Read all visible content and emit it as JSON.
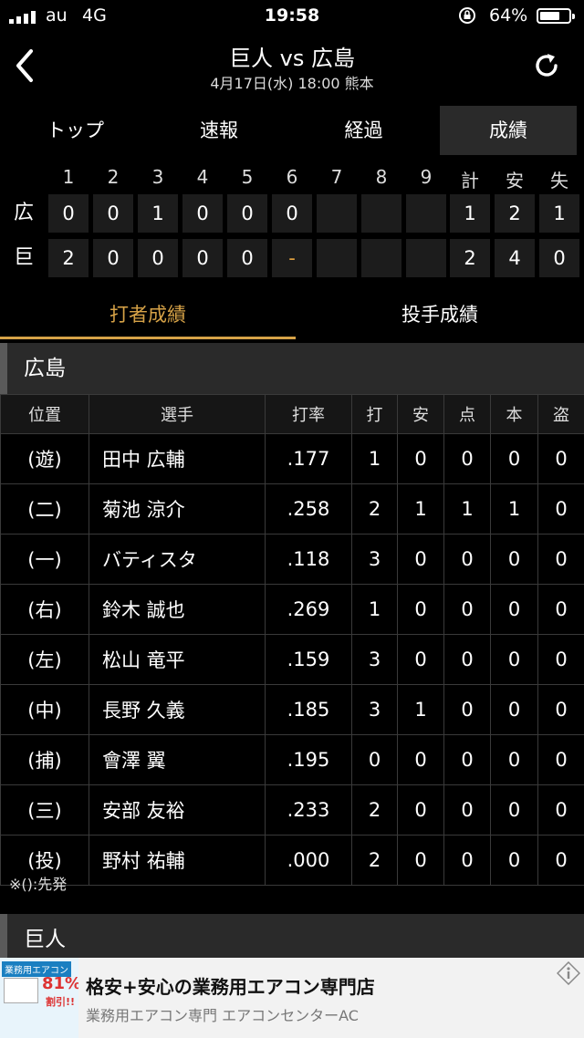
{
  "status": {
    "carrier": "au",
    "network": "4G",
    "time": "19:58",
    "battery": "64%"
  },
  "header": {
    "title": "巨人 vs 広島",
    "subtitle": "4月17日(水) 18:00 熊本"
  },
  "tabs": [
    "トップ",
    "速報",
    "経過",
    "成績"
  ],
  "active_tab": "成績",
  "scoreboard": {
    "columns": [
      "1",
      "2",
      "3",
      "4",
      "5",
      "6",
      "7",
      "8",
      "9",
      "計",
      "安",
      "失"
    ],
    "teams": [
      {
        "name": "広",
        "innings": [
          "0",
          "0",
          "1",
          "0",
          "0",
          "0",
          "",
          "",
          ""
        ],
        "totals": [
          "1",
          "2",
          "1"
        ]
      },
      {
        "name": "巨",
        "innings": [
          "2",
          "0",
          "0",
          "0",
          "0",
          "-",
          "",
          "",
          ""
        ],
        "totals": [
          "2",
          "4",
          "0"
        ]
      }
    ]
  },
  "stats_tabs": [
    "打者成績",
    "投手成績"
  ],
  "active_stats_tab": "打者成績",
  "section1": {
    "team": "広島"
  },
  "batting": {
    "headers": [
      "位置",
      "選手",
      "打率",
      "打",
      "安",
      "点",
      "本",
      "盗"
    ],
    "rows": [
      [
        "(遊)",
        "田中 広輔",
        ".177",
        "1",
        "0",
        "0",
        "0",
        "0"
      ],
      [
        "(二)",
        "菊池 涼介",
        ".258",
        "2",
        "1",
        "1",
        "1",
        "0"
      ],
      [
        "(一)",
        "バティスタ",
        ".118",
        "3",
        "0",
        "0",
        "0",
        "0"
      ],
      [
        "(右)",
        "鈴木 誠也",
        ".269",
        "1",
        "0",
        "0",
        "0",
        "0"
      ],
      [
        "(左)",
        "松山 竜平",
        ".159",
        "3",
        "0",
        "0",
        "0",
        "0"
      ],
      [
        "(中)",
        "長野 久義",
        ".185",
        "3",
        "1",
        "0",
        "0",
        "0"
      ],
      [
        "(捕)",
        "會澤 翼",
        ".195",
        "0",
        "0",
        "0",
        "0",
        "0"
      ],
      [
        "(三)",
        "安部 友裕",
        ".233",
        "2",
        "0",
        "0",
        "0",
        "0"
      ],
      [
        "(投)",
        "野村 祐輔",
        ".000",
        "2",
        "0",
        "0",
        "0",
        "0"
      ]
    ]
  },
  "note": "※():先発",
  "section2": {
    "team": "巨人"
  },
  "ad": {
    "image_tag": "業務用エアコン",
    "image_discount": "81%",
    "image_discount_label": "割引!!",
    "title": "格安+安心の業務用エアコン専門店",
    "subtitle": "業務用エアコン専門 エアコンセンターAC"
  },
  "colors": {
    "accent": "#d6a247",
    "background": "#000000",
    "cell": "#1c1c1c"
  }
}
